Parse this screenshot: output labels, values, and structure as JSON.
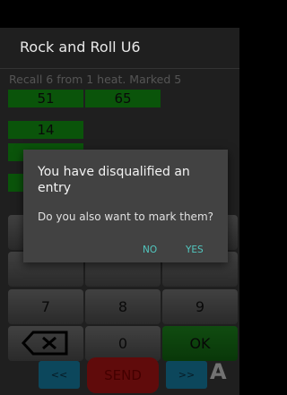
{
  "app": {
    "title": "Rock and Roll U6",
    "subtitle": "Recall 6 from 1 heat. Marked 5"
  },
  "grid": {
    "cells": [
      "51",
      "65",
      "14",
      "",
      ""
    ]
  },
  "keypad": {
    "row3": [
      "7",
      "8",
      "9"
    ],
    "zero": "0",
    "ok": "OK",
    "backspace_icon": "backspace-icon"
  },
  "bottom": {
    "prev": "<<",
    "send": "SEND",
    "next": ">>",
    "a": "A"
  },
  "dialog": {
    "title": "You have disqualified an entry",
    "message": "Do you also want to mark them?",
    "no": "NO",
    "yes": "YES"
  },
  "colors": {
    "cell_green": "#139a13",
    "ok_green": "#116611",
    "send_red": "#b01414",
    "nav_blue": "#1682a8",
    "dialog_accent": "#52c7bf"
  }
}
